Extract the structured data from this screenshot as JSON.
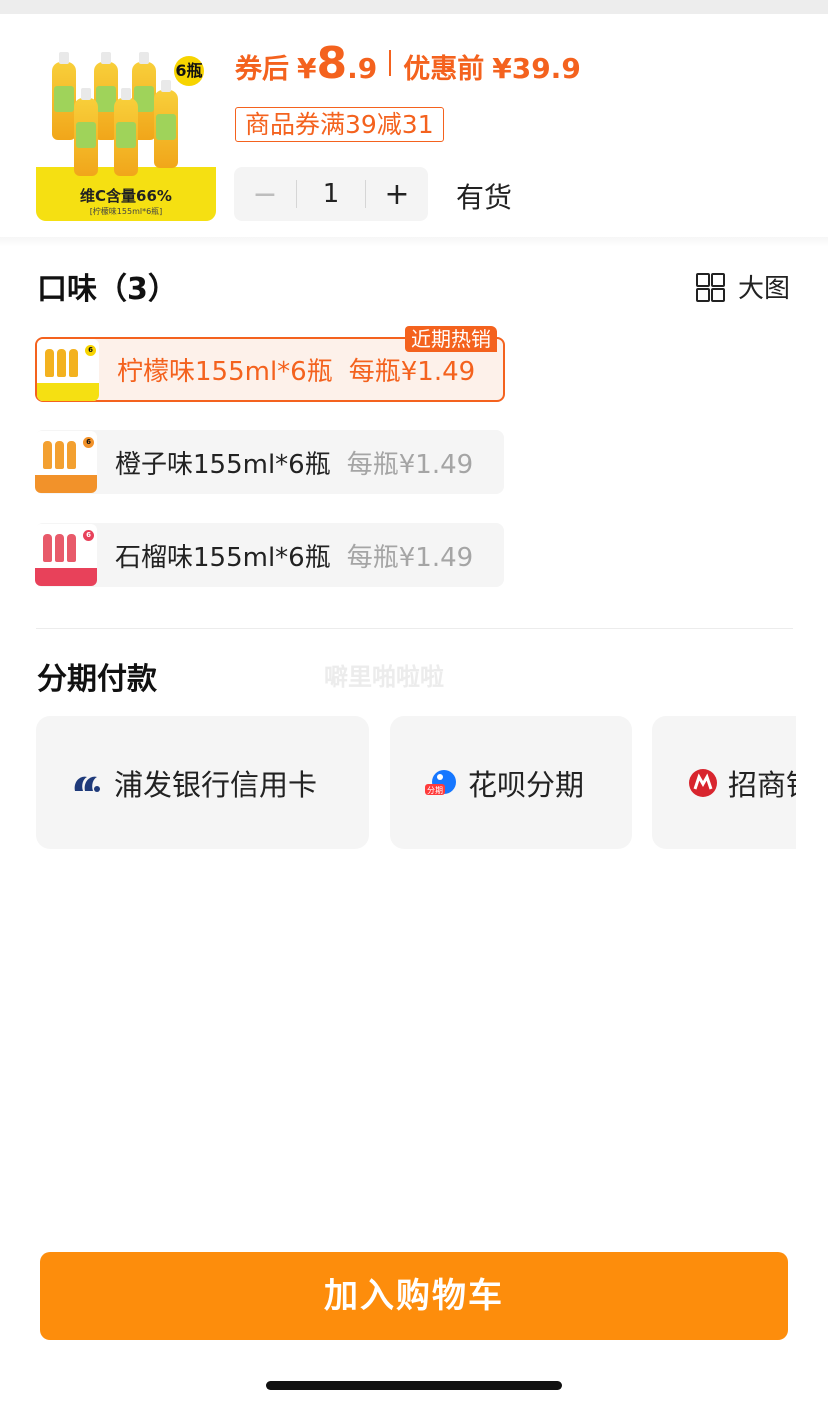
{
  "product": {
    "image_text": "维C含量66%",
    "image_subtext": "[柠檬味155ml*6瓶]",
    "image_badge": "6瓶",
    "price_label": "券后",
    "currency": "¥",
    "price_int": "8",
    "price_dec": ".9",
    "original_label": "优惠前",
    "original_price": "¥39.9",
    "coupon": "商品券满39减31",
    "quantity": "1",
    "minus": "−",
    "plus": "+",
    "stock": "有货"
  },
  "flavors": {
    "title": "口味（3）",
    "view_toggle": "大图",
    "hot_tag": "近期热销",
    "options": [
      {
        "name": "柠檬味155ml*6瓶",
        "price": "每瓶¥1.49",
        "selected": true,
        "color": "#f5e012"
      },
      {
        "name": "橙子味155ml*6瓶",
        "price": "每瓶¥1.49",
        "selected": false,
        "color": "#f2922a"
      },
      {
        "name": "石榴味155ml*6瓶",
        "price": "每瓶¥1.49",
        "selected": false,
        "color": "#e8415a"
      }
    ]
  },
  "installment": {
    "title": "分期付款",
    "watermark": "噼里啪啦啦",
    "methods": [
      {
        "label": "浦发银行信用卡",
        "icon": "spdb-logo-icon"
      },
      {
        "label": "花呗分期",
        "icon": "huabei-logo-icon",
        "badge": "分期"
      },
      {
        "label": "招商银行信用卡",
        "icon": "cmb-logo-icon"
      }
    ]
  },
  "cart_button": "加入购物车",
  "colors": {
    "accent": "#f4621e",
    "cart": "#fd8d0c"
  }
}
